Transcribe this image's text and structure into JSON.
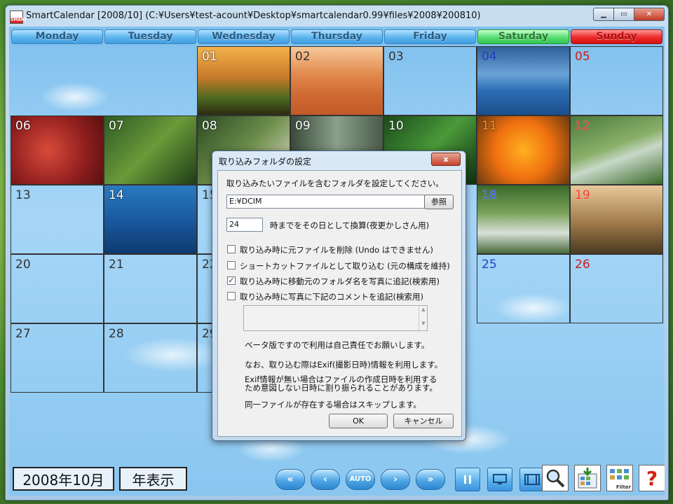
{
  "window": {
    "title": "SmartCalendar [2008/10] (C:¥Users¥test-acount¥Desktop¥smartcalendar0.99¥files¥2008¥200810)",
    "icon_text": "SMART"
  },
  "days": [
    "Monday",
    "Tuesday",
    "Wednesday",
    "Thursday",
    "Friday",
    "Saturday",
    "Sunday"
  ],
  "calendar": {
    "rows": [
      [
        "",
        "",
        "01",
        "02",
        "03",
        "04",
        "05"
      ],
      [
        "06",
        "07",
        "08",
        "09",
        "10",
        "11",
        "12"
      ],
      [
        "13",
        "14",
        "15",
        "",
        "",
        "18",
        "19"
      ],
      [
        "20",
        "21",
        "22",
        "",
        "",
        "25",
        "26"
      ],
      [
        "27",
        "28",
        "29",
        "",
        "",
        "",
        ""
      ]
    ]
  },
  "footer": {
    "month_label": "2008年10月",
    "year_view_button": "年表示",
    "auto_label": "AUTO",
    "filter_label": "Filter",
    "help_glyph": "?"
  },
  "dialog": {
    "title": "取り込みフォルダの設定",
    "close_glyph": "x",
    "instruction": "取り込みたいファイルを含むフォルダを設定してください。",
    "folder_value": "E:¥DCIM",
    "browse_button": "参照",
    "hour_value": "24",
    "hour_label": "時までをその日として換算(夜更かしさん用)",
    "options": [
      {
        "label": "取り込み時に元ファイルを削除 (Undo はできません)",
        "checked": false
      },
      {
        "label": "ショートカットファイルとして取り込む (元の構成を維持)",
        "checked": false
      },
      {
        "label": "取り込み時に移動元のフォルダ名を写真に追記(検索用)",
        "checked": true
      },
      {
        "label": "取り込み時に写真に下記のコメントを追記(検索用)",
        "checked": false
      }
    ],
    "comment_value": "",
    "notes": [
      "ベータ版ですので利用は自己責任でお願いします。",
      "なお、取り込む際はExif(撮影日時)情報を利用します。",
      "Exif情報が無い場合はファイルの作成日時を利用する",
      "ため意図しない日時に割り振られることがあります。",
      "同一ファイルが存在する場合はスキップします。"
    ],
    "ok_button": "OK",
    "cancel_button": "キャンセル"
  },
  "colors": {
    "saturday": "#2440c0",
    "sunday": "#d21a1a",
    "weekday_header": "#3f9de0"
  }
}
